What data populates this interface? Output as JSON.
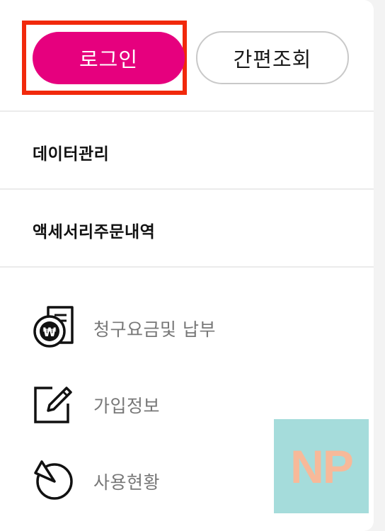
{
  "auth": {
    "login_label": "로그인",
    "quick_lookup_label": "간편조회"
  },
  "menu": {
    "main_items": [
      {
        "label": "데이터관리"
      },
      {
        "label": "액세서리주문내역"
      }
    ],
    "sub_items": [
      {
        "label": "청구요금및 납부",
        "icon": "bill-payment-icon"
      },
      {
        "label": "가입정보",
        "icon": "edit-icon"
      },
      {
        "label": "사용현황",
        "icon": "usage-pie-icon"
      }
    ]
  },
  "watermark": {
    "text": "NP"
  },
  "colors": {
    "login_button": "#e6007e",
    "highlight_border": "#f1290c",
    "watermark_bg": "#a5dcdb",
    "watermark_text": "#f7b999"
  }
}
